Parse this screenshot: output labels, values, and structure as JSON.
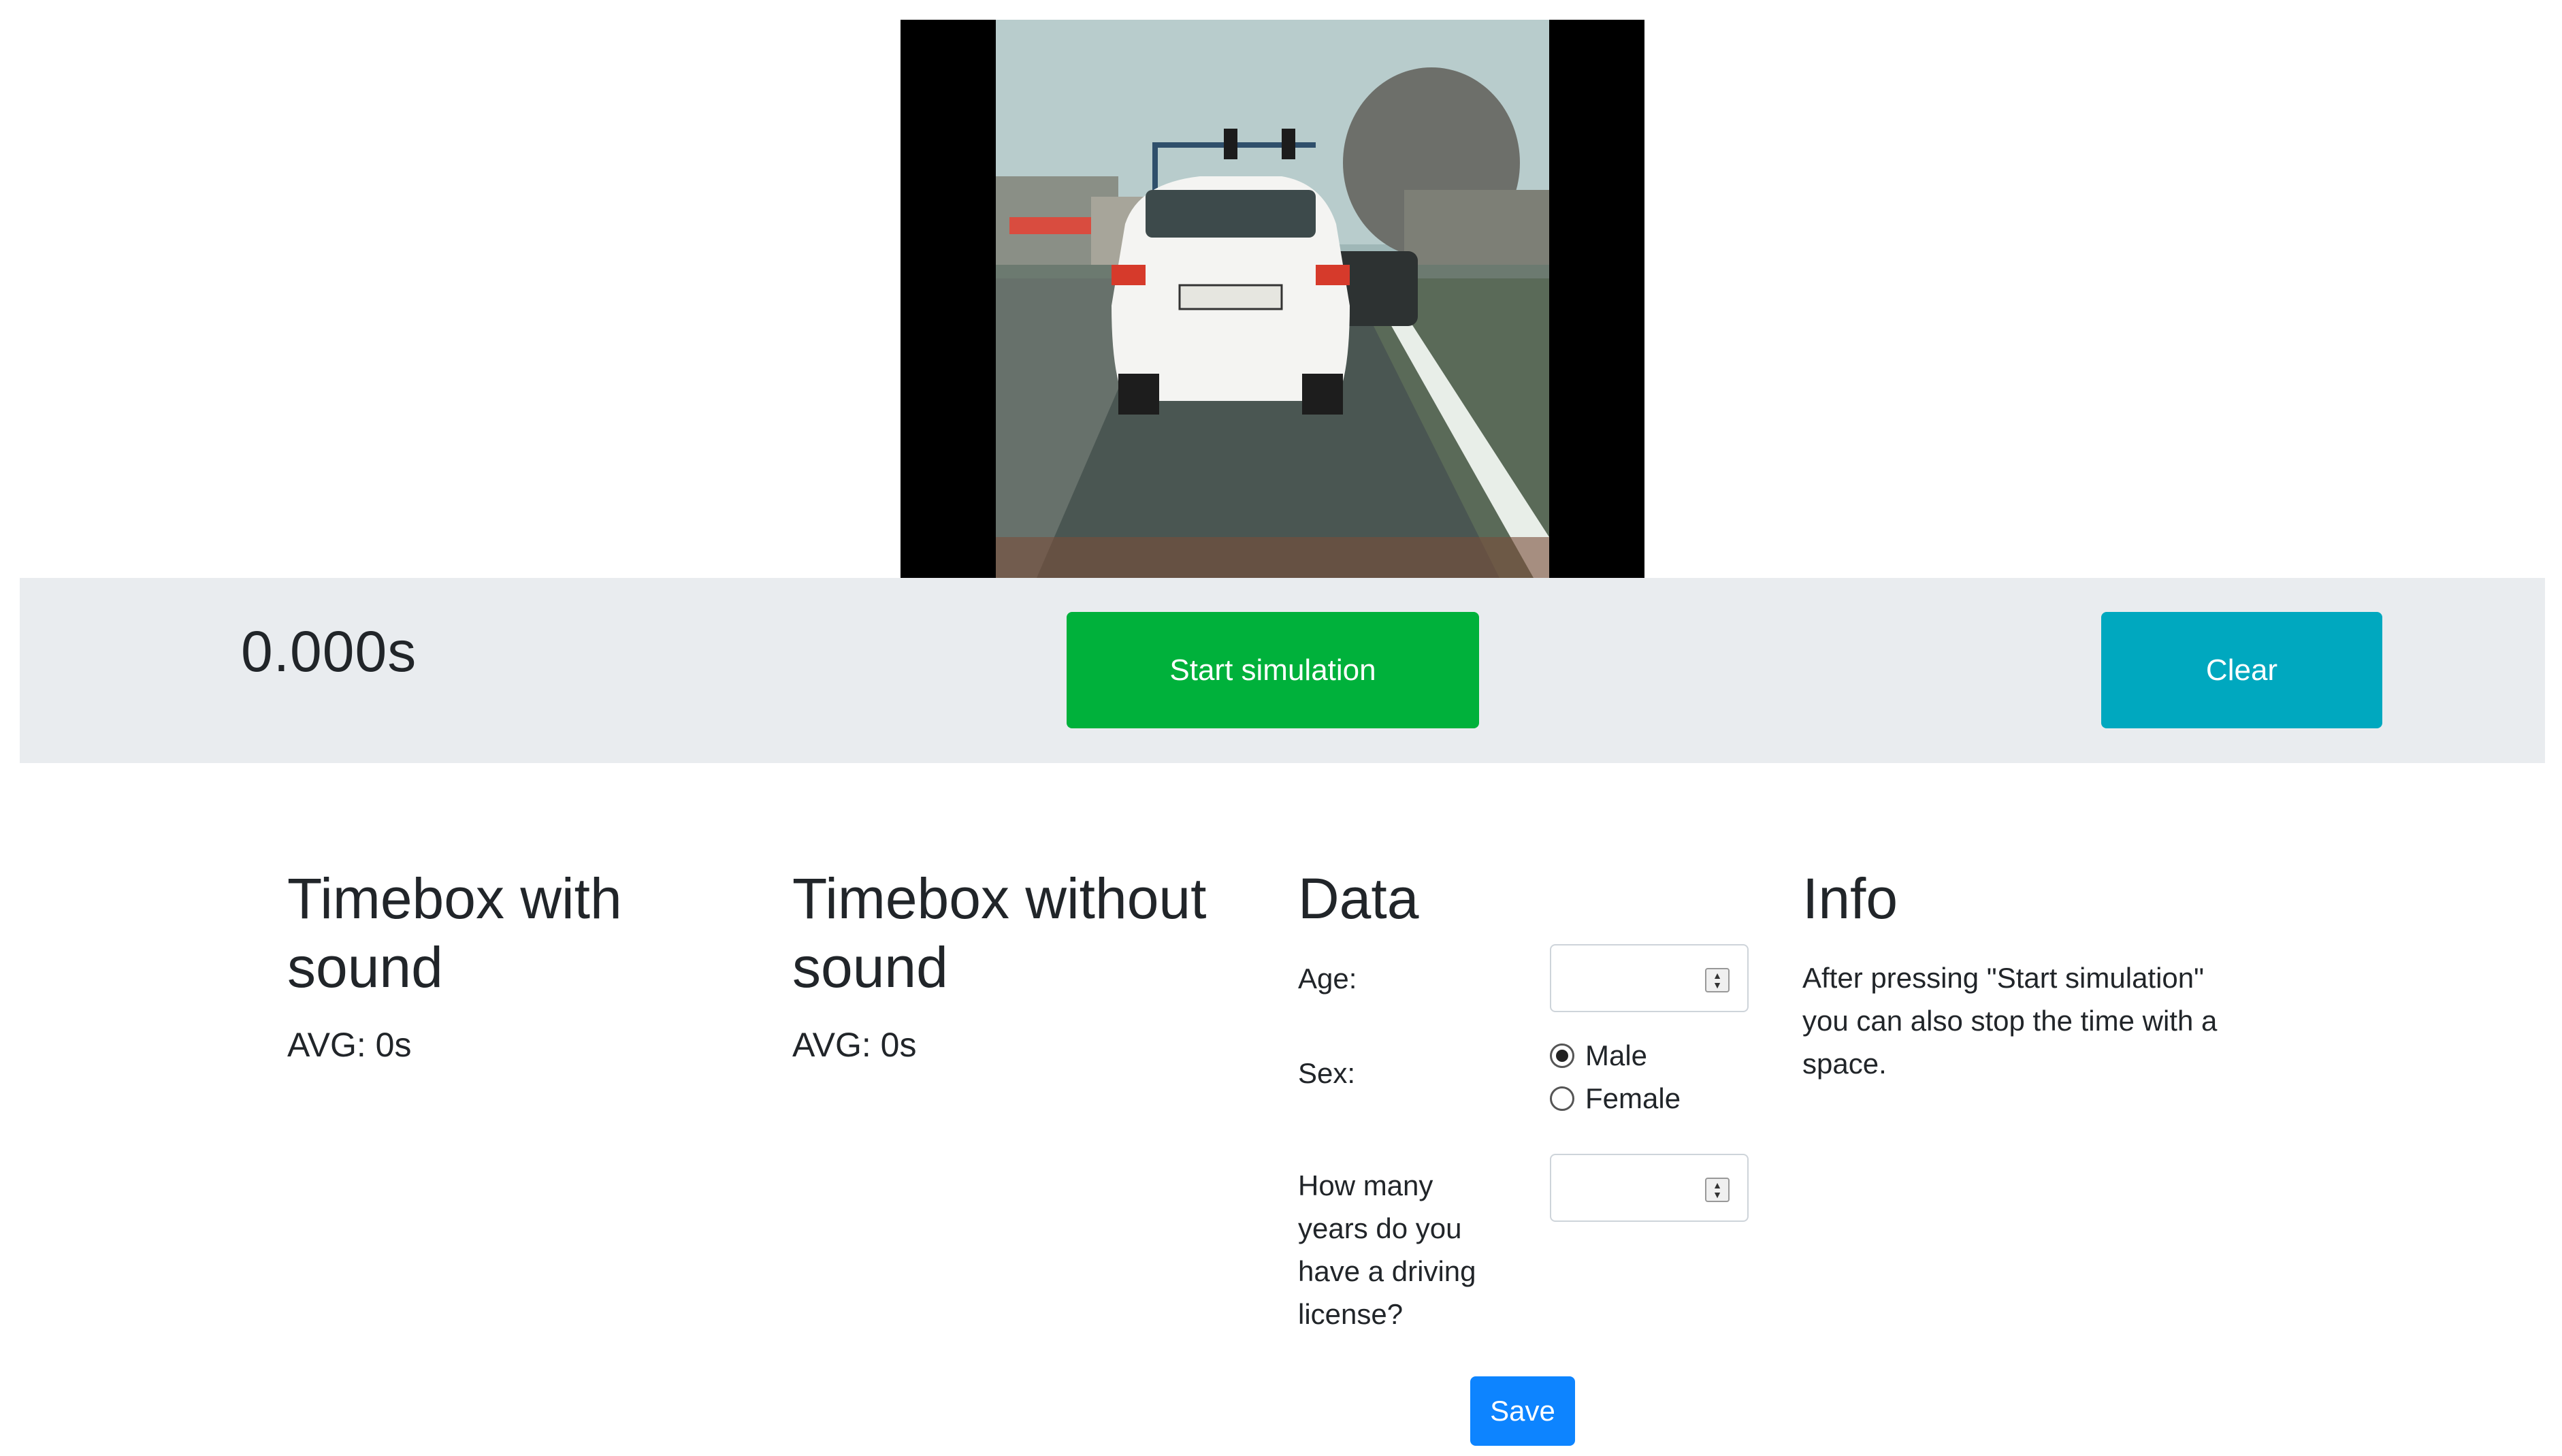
{
  "timer": {
    "value": "0.000s"
  },
  "controls": {
    "start_label": "Start simulation",
    "clear_label": "Clear",
    "start_color": "#00b13b",
    "clear_color": "#00a8bf"
  },
  "timebox_sound": {
    "title": "Timebox with sound",
    "avg": "AVG: 0s"
  },
  "timebox_nosound": {
    "title": "Timebox without sound",
    "avg": "AVG: 0s"
  },
  "data_form": {
    "title": "Data",
    "age_label": "Age:",
    "age_value": "",
    "sex_label": "Sex:",
    "sex_options": [
      "Male",
      "Female"
    ],
    "sex_selected": "Male",
    "license_years_label": "How many years do you have a driving license?",
    "license_years_value": "",
    "save_label": "Save",
    "save_color": "#0d84ff"
  },
  "info": {
    "title": "Info",
    "text": "After pressing \"Start simulation\" you can also stop the time with a space."
  },
  "icons": {
    "video": "dashcam-video-frame",
    "spinner": "number-spinner-icon",
    "radio": "radio-icon"
  }
}
